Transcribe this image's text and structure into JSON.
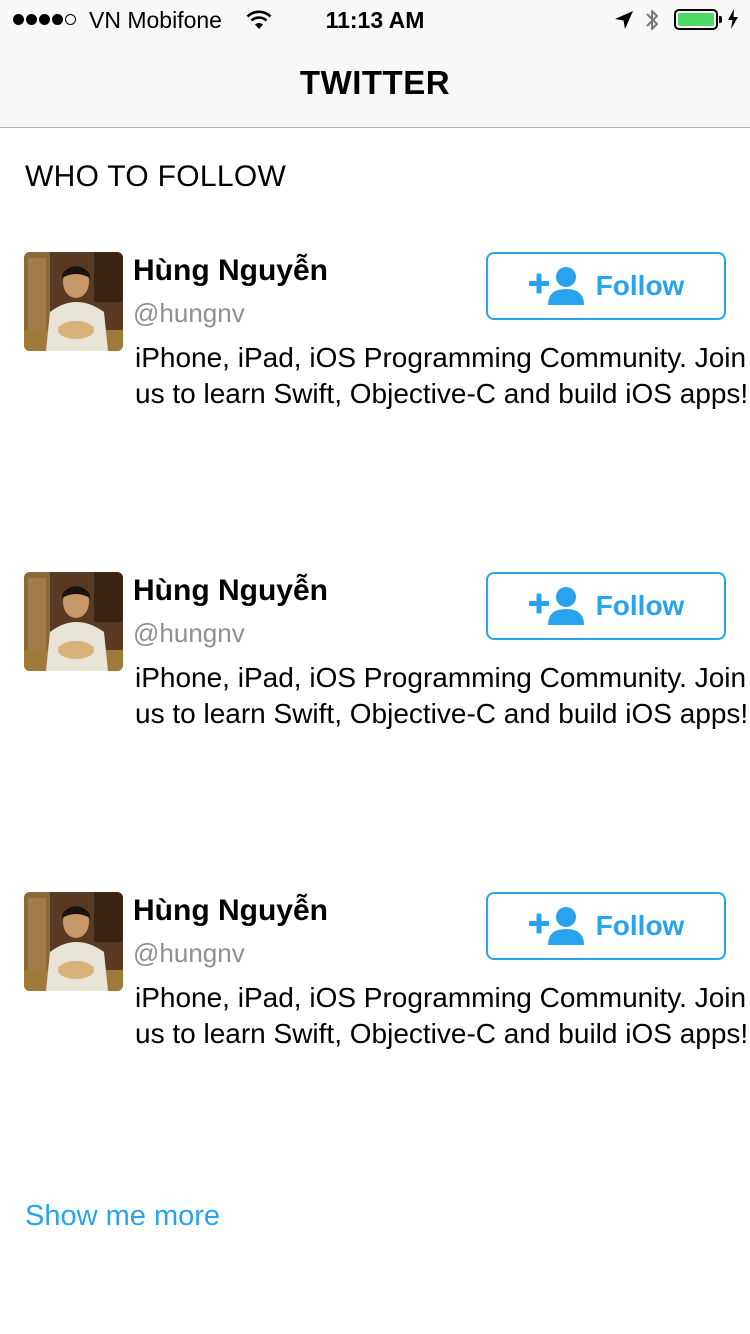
{
  "status_bar": {
    "carrier": "VN Mobifone",
    "time": "11:13 AM",
    "battery_color": "#4cd964"
  },
  "nav": {
    "title": "TWITTER"
  },
  "section": {
    "title": "WHO TO FOLLOW"
  },
  "accent_color": "#2aa3ef",
  "suggestions": [
    {
      "name": "Hùng Nguyễn",
      "handle": "@hungnv",
      "bio": "iPhone, iPad, iOS Programming Community. Join us to learn Swift, Objective-C and build iOS apps!",
      "button_label": "Follow",
      "button_icon": "add-user-icon"
    },
    {
      "name": "Hùng Nguyễn",
      "handle": "@hungnv",
      "bio": "iPhone, iPad, iOS Programming Community. Join us to learn Swift, Objective-C and build iOS apps!",
      "button_label": "Follow",
      "button_icon": "add-user-icon"
    },
    {
      "name": "Hùng Nguyễn",
      "handle": "@hungnv",
      "bio": "iPhone, iPad, iOS Programming Community. Join us to learn Swift, Objective-C and build iOS apps!",
      "button_label": "Follow",
      "button_icon": "add-user-icon"
    }
  ],
  "footer": {
    "show_more_label": "Show me more"
  }
}
